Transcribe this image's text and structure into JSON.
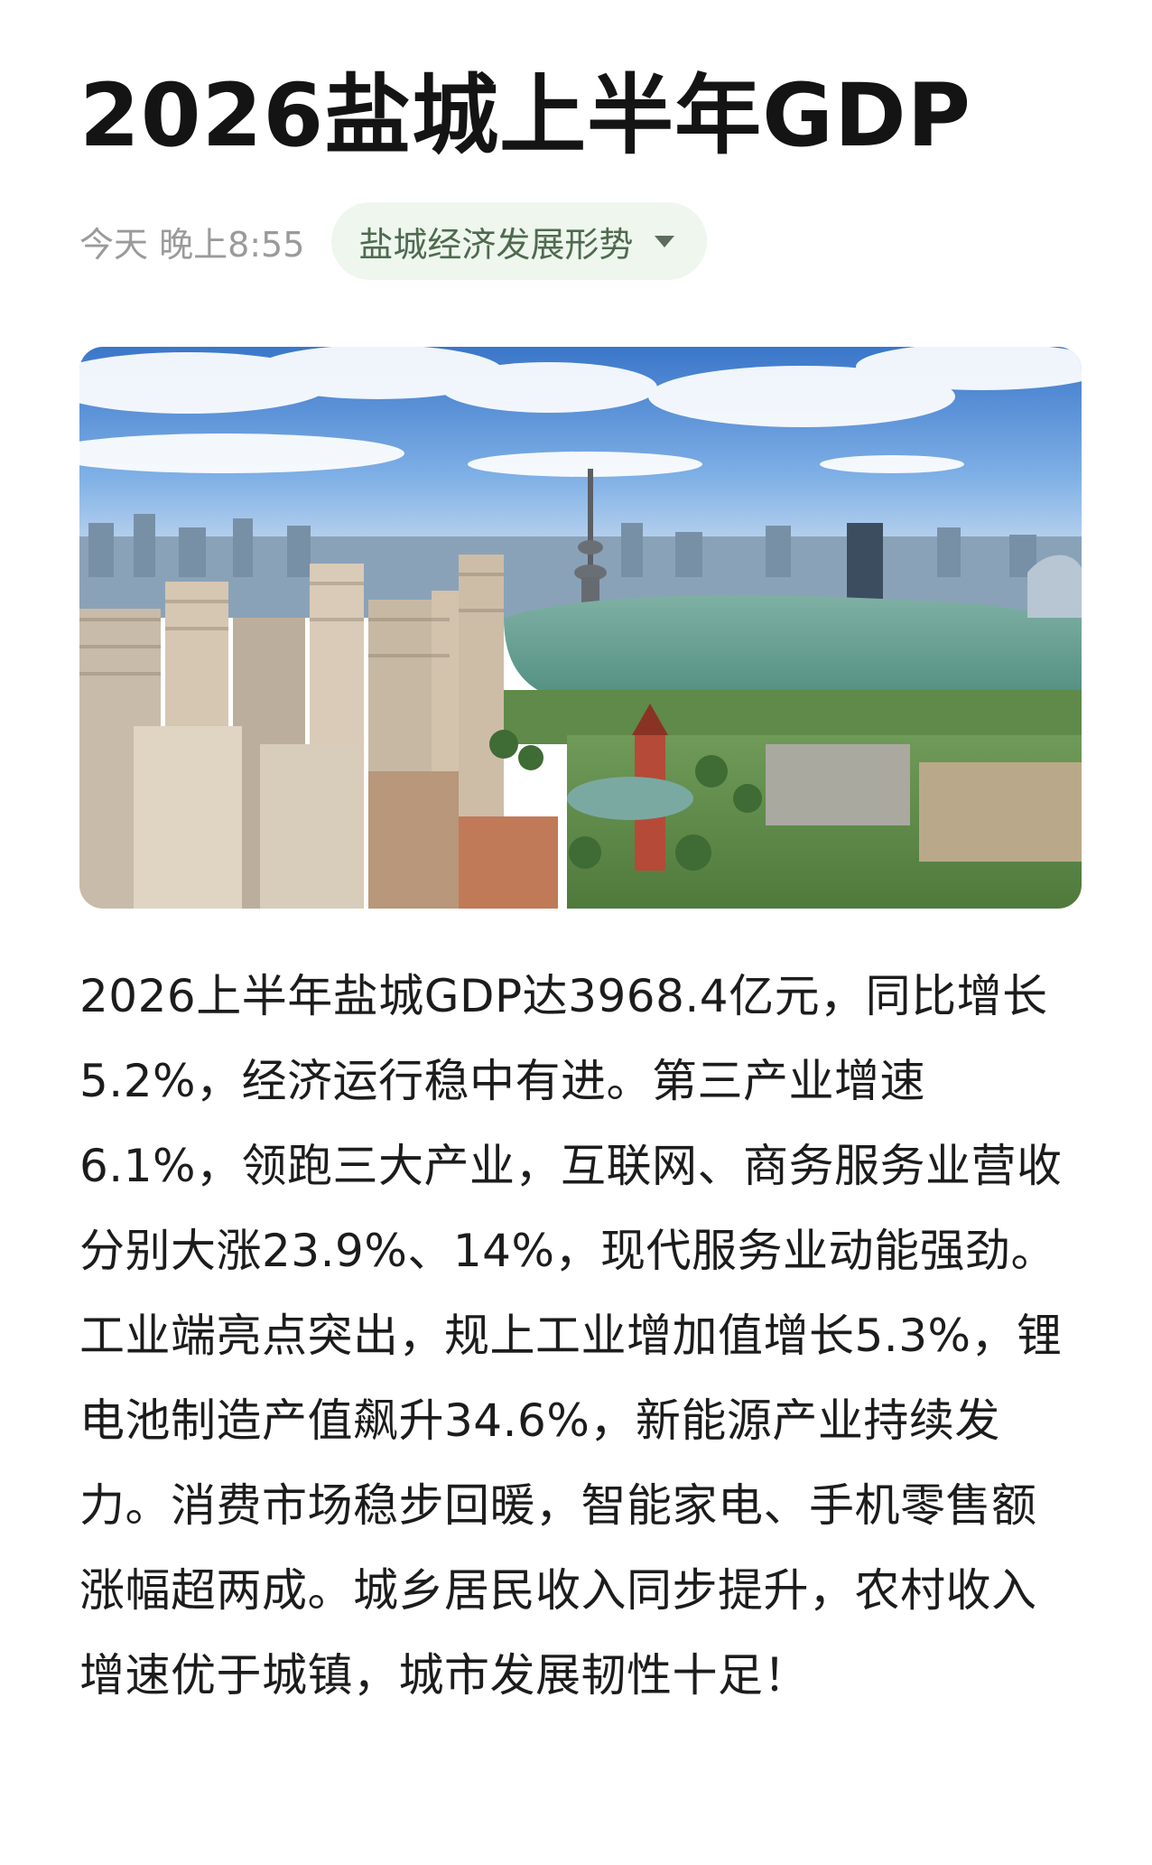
{
  "article": {
    "title": "2026盐城上半年GDP",
    "time": "今天 晚上8:55",
    "topic": "盐城经济发展形势",
    "body": "2026上半年盐城GDP达3968.4亿元，同比增长5.2%，经济运行稳中有进。第三产业增速6.1%，领跑三大产业，互联网、商务服务业营收分别大涨23.9%、14%，现代服务业动能强劲。工业端亮点突出，规上工业增加值增长5.3%，锂电池制造产值飙升34.6%，新能源产业持续发力。消费市场稳步回暖，智能家电、手机零售额涨幅超两成。城乡居民收入同步提升，农村收入增速优于城镇，城市发展韧性十足！"
  },
  "icons": {
    "topic_caret": "caret-down-icon"
  },
  "colors": {
    "chip_background": "#eef6ee",
    "chip_text": "#4f6a4f",
    "meta_text": "#9a9a9a",
    "title_text": "#141414"
  }
}
